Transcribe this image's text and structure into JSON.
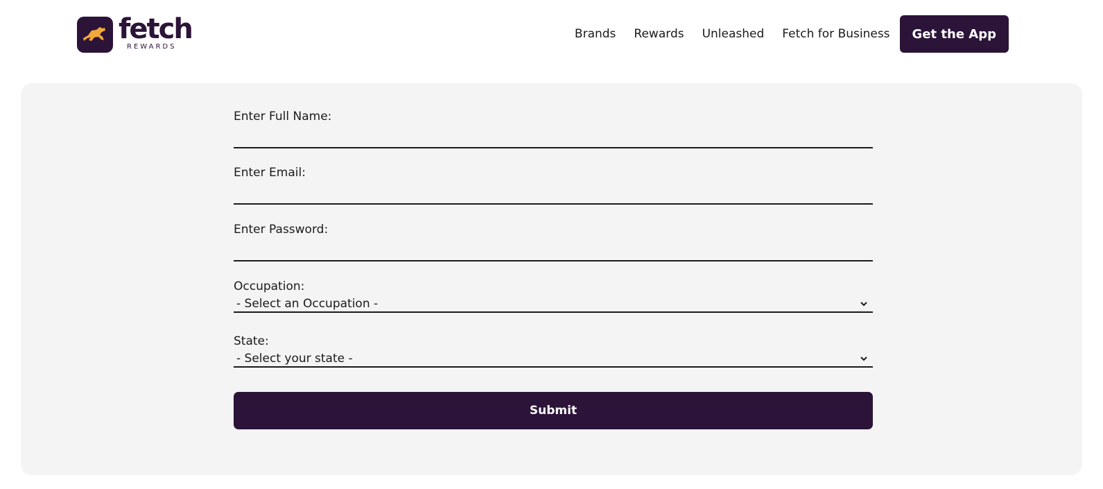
{
  "brand": {
    "name": "fetch",
    "sub": "REWARDS",
    "color": "#2c1338",
    "accent": "#f2a93b"
  },
  "nav": {
    "links": [
      "Brands",
      "Rewards",
      "Unleashed",
      "Fetch for Business"
    ],
    "cta_label": "Get the App"
  },
  "form": {
    "full_name_label": "Enter Full Name:",
    "full_name_value": "",
    "email_label": "Enter Email:",
    "email_value": "",
    "password_label": "Enter Password:",
    "password_value": "",
    "occupation_label": "Occupation:",
    "occupation_selected": "- Select an Occupation -",
    "state_label": "State:",
    "state_selected": "- Select your state -",
    "submit_label": "Submit"
  },
  "icons": {
    "logo": "running-dog-icon",
    "select": "chevron-down-icon"
  }
}
